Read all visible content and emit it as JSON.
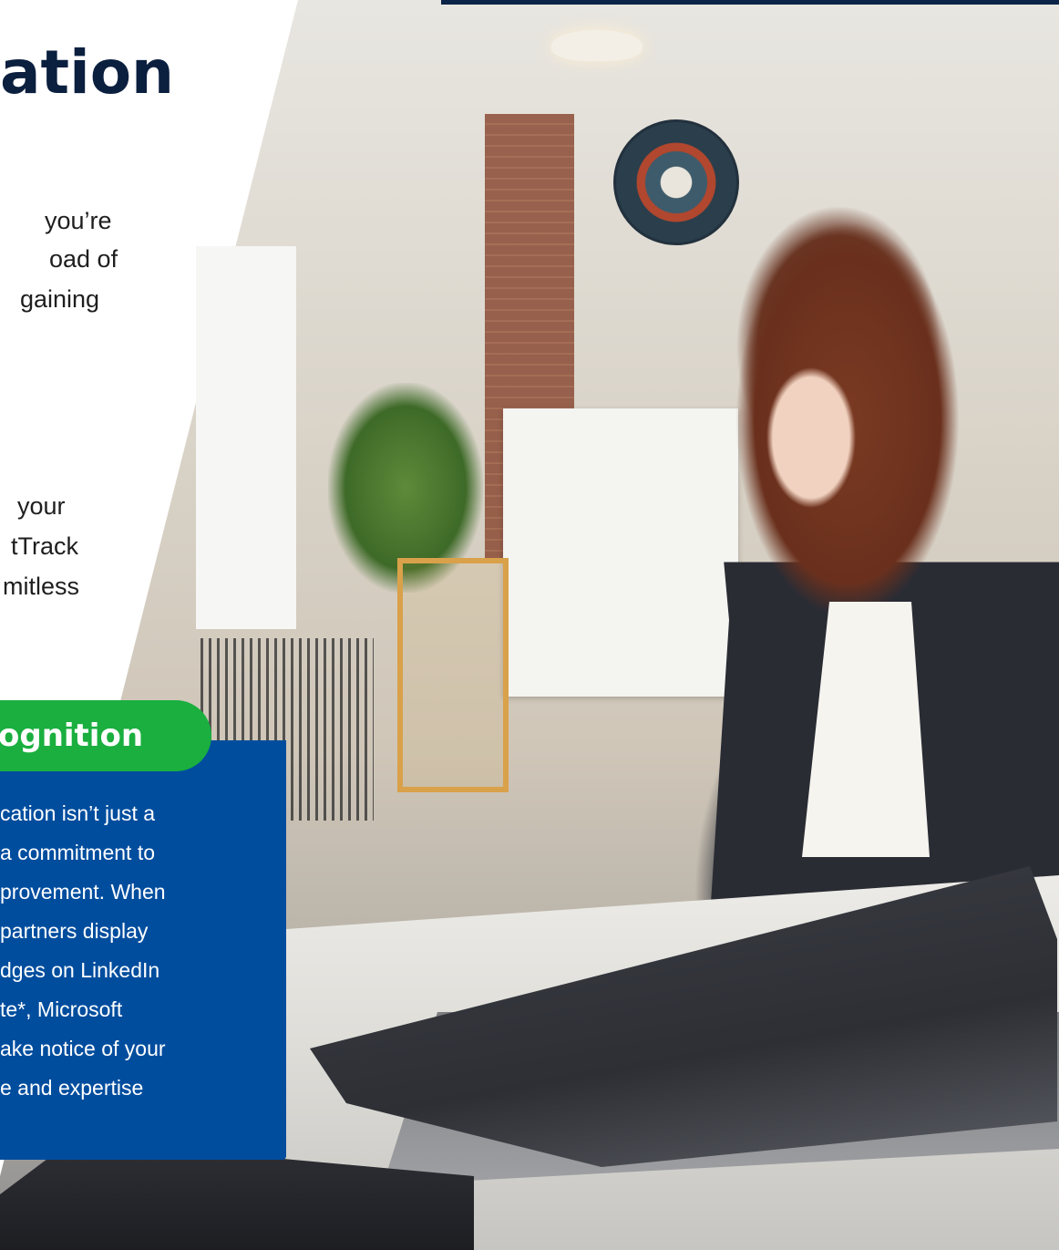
{
  "heading": {
    "title": "ation"
  },
  "intro": {
    "lines": [
      "you’re",
      "oad of",
      "gaining"
    ]
  },
  "second": {
    "lines": [
      "your",
      "tTrack",
      "mitless"
    ]
  },
  "recognition": {
    "tab_label": "ognition",
    "lines": [
      "cation isn’t just a",
      "a commitment to",
      "provement. When",
      "partners display",
      "dges on LinkedIn",
      "te*, Microsoft",
      "ake notice of your",
      "e and expertise"
    ]
  },
  "colors": {
    "navy": "#0b1f3f",
    "green": "#1aaf3f",
    "blue_panel": "#004d9e"
  }
}
